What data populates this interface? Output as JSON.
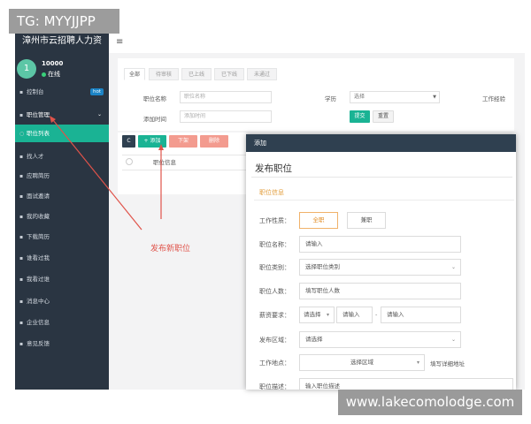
{
  "watermarks": {
    "top": "TG: MYYJJPP",
    "bottom": "www.lakecomolodge.com"
  },
  "app": {
    "title": "漳州市云招聘人力资"
  },
  "user": {
    "avatar_initial": "1",
    "name": "10000",
    "status": "在线"
  },
  "sidebar": {
    "items": [
      {
        "label": "控制台",
        "badge": "hot"
      },
      {
        "label": "职位管理"
      },
      {
        "label": "职位列表"
      },
      {
        "label": "找人才"
      },
      {
        "label": "应聘简历"
      },
      {
        "label": "面试邀请"
      },
      {
        "label": "我的收藏"
      },
      {
        "label": "下载简历"
      },
      {
        "label": "谁看过我"
      },
      {
        "label": "我看过谁"
      },
      {
        "label": "消息中心"
      },
      {
        "label": "企业信息"
      },
      {
        "label": "意见反馈"
      }
    ]
  },
  "topbar": {
    "menu_icon": "≡"
  },
  "list": {
    "tabs": [
      "全部",
      "待审核",
      "已上线",
      "已下线",
      "未通过"
    ],
    "filters": {
      "position_name_label": "职位名称",
      "position_name_placeholder": "职位名称",
      "add_time_label": "添加时间",
      "add_time_placeholder": "添加时间",
      "education_label": "学历",
      "education_value": "选择",
      "experience_label": "工作经验",
      "submit": "提交",
      "reset": "重置"
    },
    "toolbar": {
      "refresh": "C",
      "add": "+ 添加",
      "offline": "下架",
      "delete": "删除"
    },
    "table_header": "职位信息"
  },
  "annotation": "发布新职位",
  "modal": {
    "header": "添加",
    "title": "发布职位",
    "section": "职位信息",
    "job_type": {
      "label": "工作性质：",
      "options": [
        "全职",
        "兼职"
      ]
    },
    "position_name": {
      "label": "职位名称：",
      "placeholder": "请输入"
    },
    "category": {
      "label": "职位类别：",
      "placeholder": "选择职位类别"
    },
    "headcount": {
      "label": "职位人数：",
      "placeholder": "填写职位人数"
    },
    "salary": {
      "label": "薪资要求：",
      "select": "请选择",
      "min": "请输入",
      "max": "请输入"
    },
    "region": {
      "label": "发布区域：",
      "placeholder": "请选择"
    },
    "location": {
      "label": "工作地点：",
      "placeholder": "选择区域",
      "detail": "填写详细地址"
    },
    "description": {
      "label": "职位描述：",
      "placeholder": "输入职位描述"
    }
  },
  "colors": {
    "sidebar": "#2a3542",
    "accent": "#1ab394",
    "modal_header": "#2f4050",
    "annotation": "#e0534a"
  }
}
